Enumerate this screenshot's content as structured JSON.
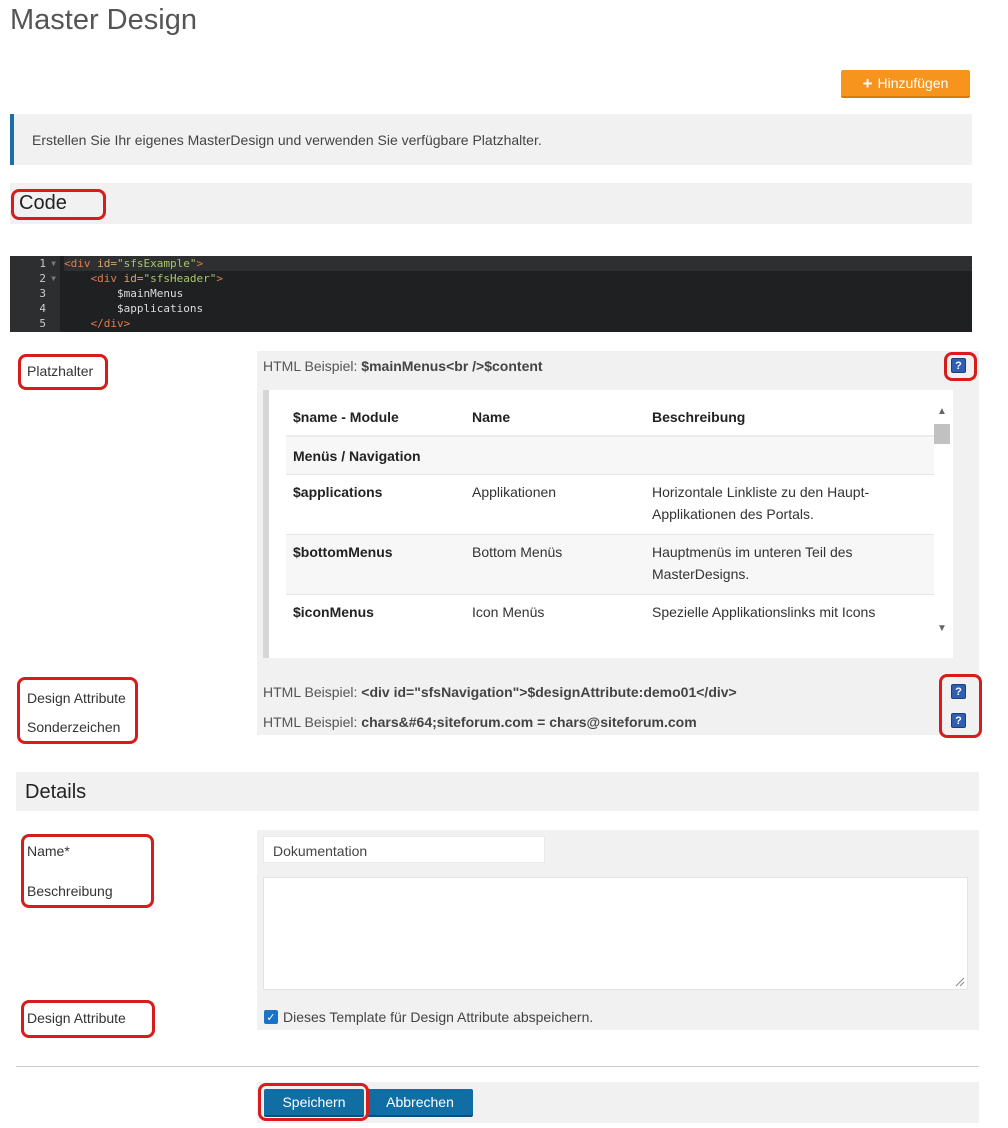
{
  "page": {
    "title": "Master Design",
    "add_button": "Hinzufügen",
    "info_text": "Erstellen Sie Ihr eigenes MasterDesign und verwenden Sie verfügbare Platzhalter."
  },
  "code_section": {
    "heading": "Code",
    "line_numbers": [
      "1",
      "2",
      "3",
      "4",
      "5"
    ],
    "lines": [
      {
        "indent": "",
        "pre": "<div ",
        "attr": "id=",
        "str": "\"sfsExample\"",
        "post": ">"
      },
      {
        "indent": "    ",
        "pre": "<div ",
        "attr": "id=",
        "str": "\"sfsHeader\"",
        "post": ">"
      },
      {
        "indent": "        ",
        "var": "$mainMenus"
      },
      {
        "indent": "        ",
        "var": "$applications"
      },
      {
        "indent": "    ",
        "pre": "</div>"
      }
    ]
  },
  "placeholders": {
    "label": "Platzhalter",
    "example_prefix": "HTML Beispiel: ",
    "example_value": "$mainMenus<br />$content",
    "help_icon": "?",
    "table": {
      "headers": [
        "$name - Module",
        "Name",
        "Beschreibung"
      ],
      "group": "Menüs / Navigation",
      "rows": [
        {
          "name": "$applications",
          "label": "Applikationen",
          "desc": "Horizontale Linkliste zu den Haupt-Applikationen des Portals."
        },
        {
          "name": "$bottomMenus",
          "label": "Bottom Menüs",
          "desc": "Hauptmenüs im unteren Teil des MasterDesigns."
        },
        {
          "name": "$iconMenus",
          "label": "Icon Menüs",
          "desc": "Spezielle Applikationslinks mit Icons"
        }
      ]
    }
  },
  "design_attribute": {
    "label": "Design Attribute",
    "example_prefix": "HTML Beispiel: ",
    "example_value": "<div id=\"sfsNavigation\">$designAttribute:demo01</div>"
  },
  "special_chars": {
    "label": "Sonderzeichen",
    "example_prefix": "HTML Beispiel: ",
    "example_value": "chars&#64;siteforum.com = chars@siteforum.com"
  },
  "details": {
    "heading": "Details",
    "name_label": "Name*",
    "name_value": "Dokumentation",
    "description_label": "Beschreibung",
    "description_value": "",
    "design_attribute_label": "Design Attribute",
    "checkbox_label": "Dieses Template für Design Attribute abspeichern.",
    "checkbox_checked": true
  },
  "actions": {
    "save": "Speichern",
    "cancel": "Abbrechen"
  },
  "colors": {
    "accent_orange": "#f7941d",
    "primary_blue": "#106ea5",
    "annotation_red": "#d81c1c"
  }
}
